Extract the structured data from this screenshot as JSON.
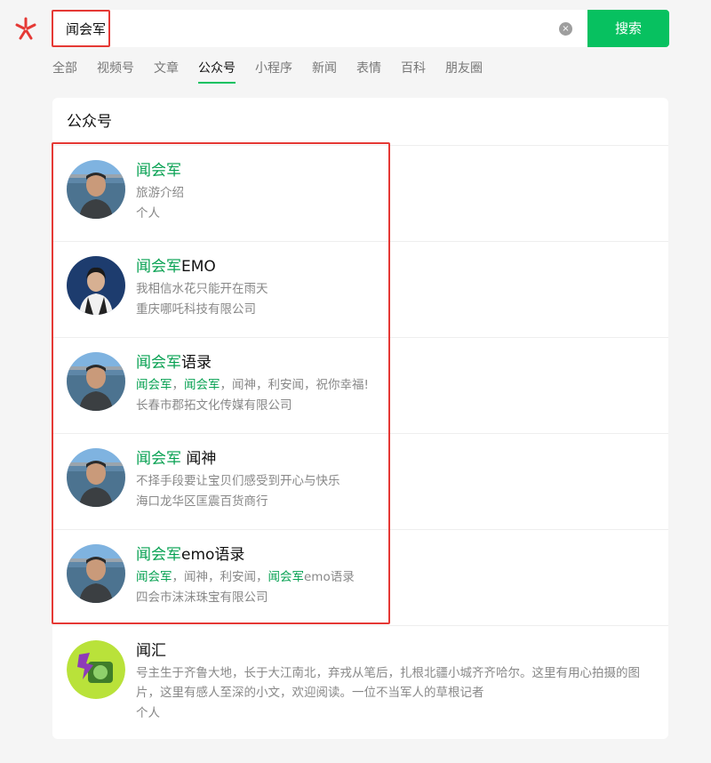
{
  "search": {
    "query": "闻会军",
    "clear_label": "×",
    "button_label": "搜索"
  },
  "tabs": [
    {
      "label": "全部"
    },
    {
      "label": "视频号"
    },
    {
      "label": "文章"
    },
    {
      "label": "公众号",
      "active": true
    },
    {
      "label": "小程序"
    },
    {
      "label": "新闻"
    },
    {
      "label": "表情"
    },
    {
      "label": "百科"
    },
    {
      "label": "朋友圈"
    }
  ],
  "section": {
    "title": "公众号"
  },
  "results": [
    {
      "name": [
        {
          "t": "闻会军",
          "hl": true
        }
      ],
      "desc": [
        {
          "t": "旅游介绍",
          "hl": false
        }
      ],
      "owner": "个人",
      "avatar": "man-lake-photo"
    },
    {
      "name": [
        {
          "t": "闻会军",
          "hl": true
        },
        {
          "t": "EMO",
          "hl": false
        }
      ],
      "desc": [
        {
          "t": "我相信水花只能开在雨天",
          "hl": false
        }
      ],
      "owner": "重庆哪吒科技有限公司",
      "avatar": "young-man-photo"
    },
    {
      "name": [
        {
          "t": "闻会军",
          "hl": true
        },
        {
          "t": "语录",
          "hl": false
        }
      ],
      "desc": [
        {
          "t": "闻会军",
          "hl": true
        },
        {
          "t": "，",
          "hl": false
        },
        {
          "t": "闻会军",
          "hl": true
        },
        {
          "t": "，闻神，利安闻，祝你幸福!",
          "hl": false
        }
      ],
      "owner": "长春市郡拓文化传媒有限公司",
      "avatar": "man-lake-photo"
    },
    {
      "name": [
        {
          "t": "闻会军",
          "hl": true
        },
        {
          "t": " 闻神",
          "hl": false
        }
      ],
      "desc": [
        {
          "t": "不择手段要让宝贝们感受到开心与快乐",
          "hl": false
        }
      ],
      "owner": "海口龙华区匡震百货商行",
      "avatar": "man-lake-photo"
    },
    {
      "name": [
        {
          "t": "闻会军",
          "hl": true
        },
        {
          "t": "emo语录",
          "hl": false
        }
      ],
      "desc": [
        {
          "t": "闻会军",
          "hl": true
        },
        {
          "t": "，闻神，利安闻，",
          "hl": false
        },
        {
          "t": "闻会军",
          "hl": true
        },
        {
          "t": "emo语录",
          "hl": false
        }
      ],
      "owner": "四会市沫沫珠宝有限公司",
      "avatar": "man-lake-photo"
    },
    {
      "name": [
        {
          "t": "闻汇",
          "hl": false
        }
      ],
      "desc": [
        {
          "t": "号主生于齐鲁大地，长于大江南北，弃戎从笔后，扎根北疆小城齐齐哈尔。这里有用心拍摄的图片，这里有感人至深的小文，欢迎阅读。一位不当军人的草根记者",
          "hl": false
        }
      ],
      "owner": "个人",
      "avatar": "green-logo"
    }
  ],
  "colors": {
    "accent": "#07c160",
    "highlight_text": "#07a152",
    "annotation_box": "#e53935"
  }
}
